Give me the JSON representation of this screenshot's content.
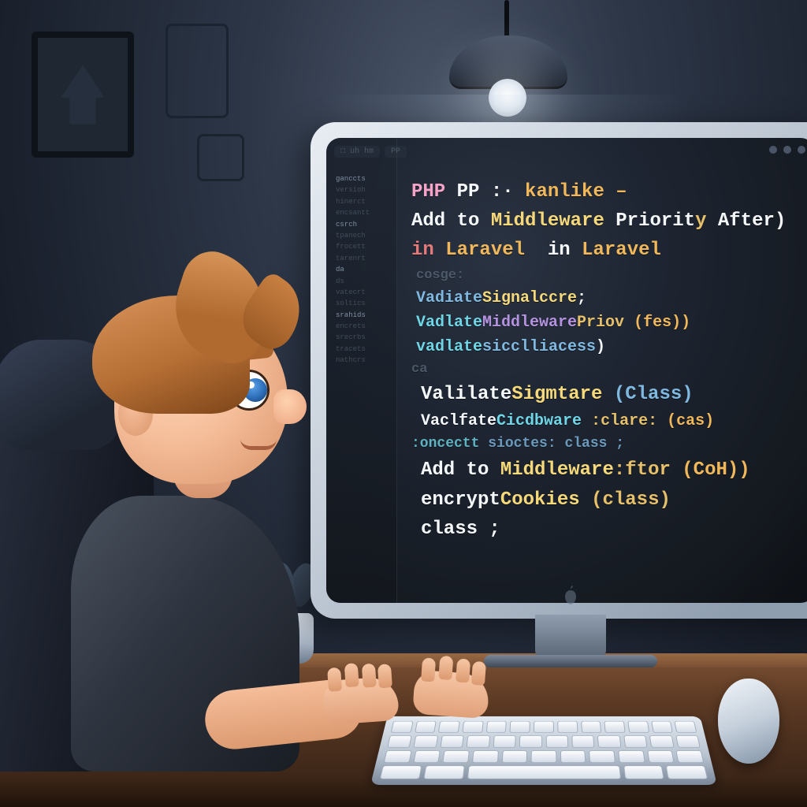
{
  "editor": {
    "tabs": [
      "□ uh hm",
      "PP"
    ],
    "sidebar": [
      "ganccts",
      "versioh",
      "hinerct",
      "encsantt",
      "csrch",
      "tpanech",
      "frocett",
      "tarenrt",
      "da",
      "ds",
      "vatecrt",
      "soltics",
      "srahids",
      "encrets",
      "srecrbs",
      "tracets",
      "nathcrs"
    ],
    "code": {
      "l1_a": "PHP",
      "l1_b": "PP :·",
      "l1_c": "kanlike –",
      "l2_a": "Add to",
      "l2_b": "Middleware",
      "l2_c": "Priorit",
      "l2_d": "y",
      "l2_e": "After)",
      "l3_a": "in",
      "l3_b": "Laravel",
      "l3_c": "in",
      "l3_d": "Laravel",
      "l4": "cosge:",
      "l5_a": "Vadiate",
      "l5_b": "Signalccre",
      "l5_c": ";",
      "l6_a": "Vadlate",
      "l6_b": "Middleware",
      "l6_c": "Priov",
      "l6_d": "(fes))",
      "l7_a": "vadlate",
      "l7_b": "sicclliacess",
      "l7_c": ")",
      "l8": "ca",
      "l9_a": "Valilate",
      "l9_b": "Sigmtare",
      "l9_c": "(Class)",
      "l10_a": "Vaclfate",
      "l10_b": "Cicdbware",
      "l10_c": ":clare:",
      "l10_d": "(cas)",
      "l11_a": ":oncectt",
      "l11_b": "sioctes: class ;",
      "l12_a": "Add to",
      "l12_b": "Middleware",
      "l12_c": ":ftor",
      "l12_d": "(CoH))",
      "l13_a": "encrypt",
      "l13_b": "Cookies",
      "l13_c": "(class)",
      "l14": "class ;"
    }
  }
}
